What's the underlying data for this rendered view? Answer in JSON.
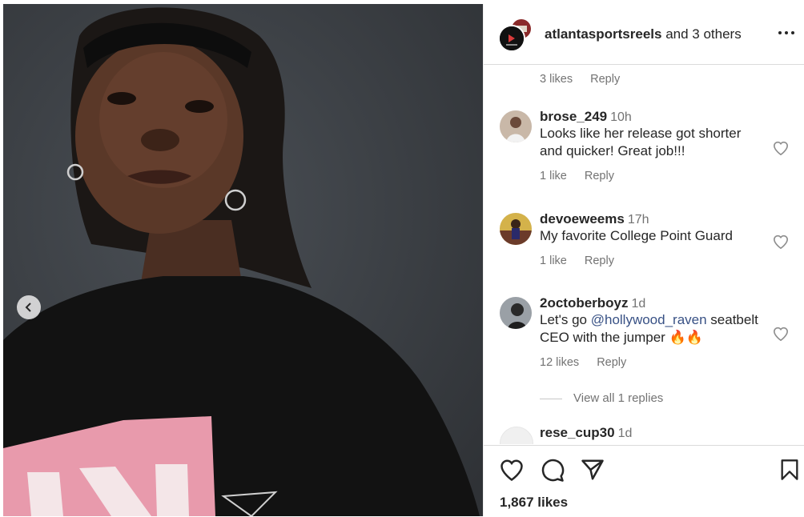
{
  "header": {
    "username": "atlantasportsreels",
    "others": "and 3 others"
  },
  "top_meta": {
    "likes": "3 likes",
    "reply": "Reply"
  },
  "comments": [
    {
      "user": "brose_249",
      "time": "10h",
      "text": "Looks like her release got shorter and quicker! Great job!!!",
      "likes": "1 like",
      "reply": "Reply"
    },
    {
      "user": "devoeweems",
      "time": "17h",
      "text": "My favorite College Point Guard",
      "likes": "1 like",
      "reply": "Reply"
    },
    {
      "user": "2octoberboyz",
      "time": "1d",
      "text_before": "Let's go ",
      "mention": "@hollywood_raven",
      "text_after": " seatbelt CEO with the jumper 🔥🔥",
      "likes": "12 likes",
      "reply": "Reply",
      "view_replies": "View all 1 replies"
    },
    {
      "user": "rese_cup30",
      "time": "1d"
    }
  ],
  "footer": {
    "likes": "1,867 likes"
  },
  "icons": {
    "more": "more-options-icon",
    "like": "heart-icon",
    "comment": "comment-icon",
    "share": "send-icon",
    "save": "bookmark-icon",
    "prev": "chevron-left-icon"
  }
}
